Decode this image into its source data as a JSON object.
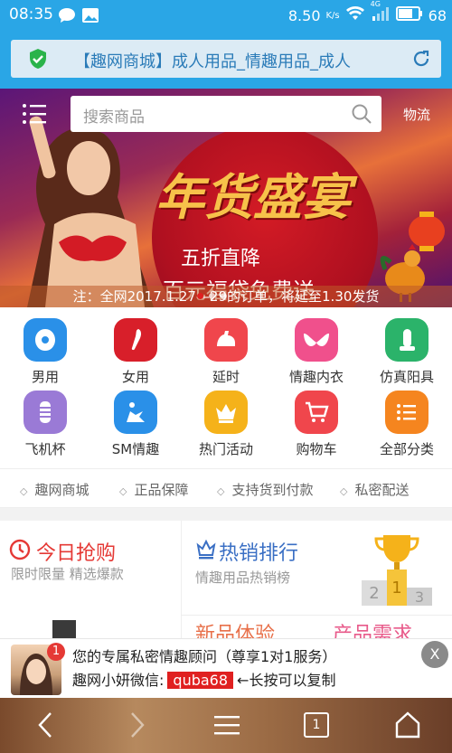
{
  "status_bar": {
    "time": "08:35",
    "speed": "8.50",
    "speed_unit": "K/s",
    "network": "4G",
    "battery": "68"
  },
  "browser": {
    "page_title": "【趣网商城】成人用品_情趣用品_成人"
  },
  "header": {
    "search_placeholder": "搜索商品",
    "logistics_label": "物流"
  },
  "banner": {
    "headline": "年货盛宴",
    "line1": "五折直降",
    "line2": "百元福袋免费送",
    "notice": "注：全网2017.1.27—29的订单，将延至1.30发货"
  },
  "categories": [
    {
      "label": "男用",
      "color": "#2a90e8",
      "icon": "male-icon"
    },
    {
      "label": "女用",
      "color": "#d81f2a",
      "icon": "female-icon"
    },
    {
      "label": "延时",
      "color": "#f0464c",
      "icon": "arm-icon"
    },
    {
      "label": "情趣内衣",
      "color": "#f0508c",
      "icon": "lingerie-icon"
    },
    {
      "label": "仿真阳具",
      "color": "#2bb36a",
      "icon": "toy-icon"
    },
    {
      "label": "飞机杯",
      "color": "#9a7ad6",
      "icon": "cup-icon"
    },
    {
      "label": "SM情趣",
      "color": "#2a90e8",
      "icon": "sm-icon"
    },
    {
      "label": "热门活动",
      "color": "#f5b21a",
      "icon": "crown-icon"
    },
    {
      "label": "购物车",
      "color": "#f0464c",
      "icon": "cart-icon"
    },
    {
      "label": "全部分类",
      "color": "#f5851f",
      "icon": "list-icon"
    }
  ],
  "guarantees": [
    "趣网商城",
    "正品保障",
    "支持货到付款",
    "私密配送"
  ],
  "promo": {
    "flash_title": "今日抢购",
    "flash_sub": "限时限量 精选爆款",
    "rank_title": "热销排行",
    "rank_sub": "情趣用品热销榜",
    "new_title": "新品体验",
    "demand_title": "产品需求"
  },
  "chat": {
    "badge": "1",
    "line1": "您的专属私密情趣顾问（尊享1对1服务）",
    "line2_prefix": "趣网小妍微信:",
    "wechat_id": "quba68",
    "line2_suffix": "←长按可以复制",
    "close": "X"
  },
  "nav": {
    "tabs_count": "1"
  }
}
